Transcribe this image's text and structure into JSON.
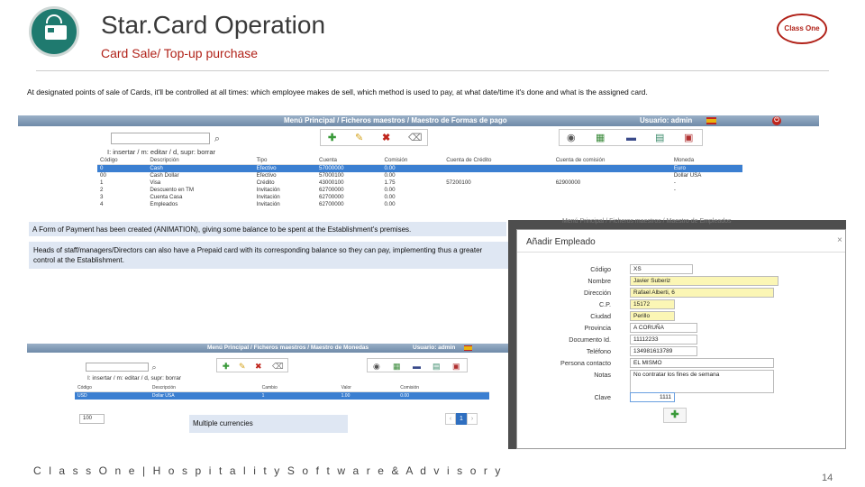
{
  "header": {
    "title": "Star.Card Operation",
    "subtitle": "Card Sale/ Top-up purchase",
    "brand_logo_text": "Class One",
    "intro": "At designated points of sale of Cards, it'll be controlled at all times: which employee makes de sell, which method is used to pay, at what date/time it's done and what is the assigned card."
  },
  "top_screen": {
    "breadcrumb": "Menú Principal /   Ficheros maestros /   Maestro de Formas de pago",
    "user": "Usuario: admin",
    "action_text": "I: insertar / m: editar / d, supr: borrar",
    "columns": [
      "Código",
      "Descripción",
      "Tipo",
      "Cuenta",
      "Comisión",
      "Cuenta de Crédito",
      "Cuenta de comisión",
      "Moneda"
    ],
    "rows": [
      [
        "0",
        "Cash",
        "Efectivo",
        "57000000",
        "0.00",
        "",
        "",
        "Euro"
      ],
      [
        "00",
        "Cash Dollar",
        "Efectivo",
        "57000100",
        "0.00",
        "",
        "",
        "Dollar USA"
      ],
      [
        "1",
        "Visa",
        "Crédito",
        "43000100",
        "1.75",
        "57200100",
        "62900000",
        "-"
      ],
      [
        "2",
        "Descuento en TM",
        "Invitación",
        "62700000",
        "0.00",
        "",
        "",
        "-"
      ],
      [
        "3",
        "Cuenta Casa",
        "Invitación",
        "62700000",
        "0.00",
        "",
        "",
        ""
      ],
      [
        "4",
        "Empleados",
        "Invitación",
        "62700000",
        "0.00",
        "",
        "",
        ""
      ]
    ]
  },
  "callouts": {
    "payment": "A Form of Payment has been created (ANIMATION), giving some balance to be spent at the Establishment's premises.",
    "staff": "Heads of staff/managers/Directors can also have a Prepaid card with its corresponding balance so they can pay, implementing thus a greater control at the Establishment.",
    "currencies": "Multiple currencies"
  },
  "bottom_screen": {
    "breadcrumb": "Menú Principal /   Ficheros maestros /   Maestro de Monedas",
    "user": "Usuario: admin",
    "action_text": "I: insertar / m: editar / d, supr: borrar",
    "columns": [
      "Código",
      "Descripción",
      "Cambio",
      "Valor",
      "Comisión"
    ],
    "row": [
      "USD",
      "Dollar USA",
      "1",
      "1.00",
      "0.00"
    ],
    "page_size": "100",
    "page": "1"
  },
  "dialog": {
    "title": "Añadir Empleado",
    "close": "×",
    "bg_breadcrumb": "Menú Principal /  Ficheros maestros /  Maestro de Empleados",
    "fields": [
      {
        "label": "Código",
        "value": "XS"
      },
      {
        "label": "Nombre",
        "value": "Javier Suberiz"
      },
      {
        "label": "Dirección",
        "value": "Rafael Alberti, 6"
      },
      {
        "label": "C.P.",
        "value": "15172"
      },
      {
        "label": "Ciudad",
        "value": "Perillo"
      },
      {
        "label": "Provincia",
        "value": "A CORUÑA"
      },
      {
        "label": "Documento Id.",
        "value": "11112233"
      },
      {
        "label": "Teléfono",
        "value": "134981613789"
      },
      {
        "label": "Persona contacto",
        "value": "EL MISMO"
      },
      {
        "label": "Notas",
        "value": "No contratar los fines de semana"
      },
      {
        "label": "Clave",
        "value": "1111"
      }
    ]
  },
  "footer": {
    "text": "C l a s s O n e | H o s p i t a l i t y S o f t w a r e & A d v i s o r y",
    "page": "14"
  }
}
